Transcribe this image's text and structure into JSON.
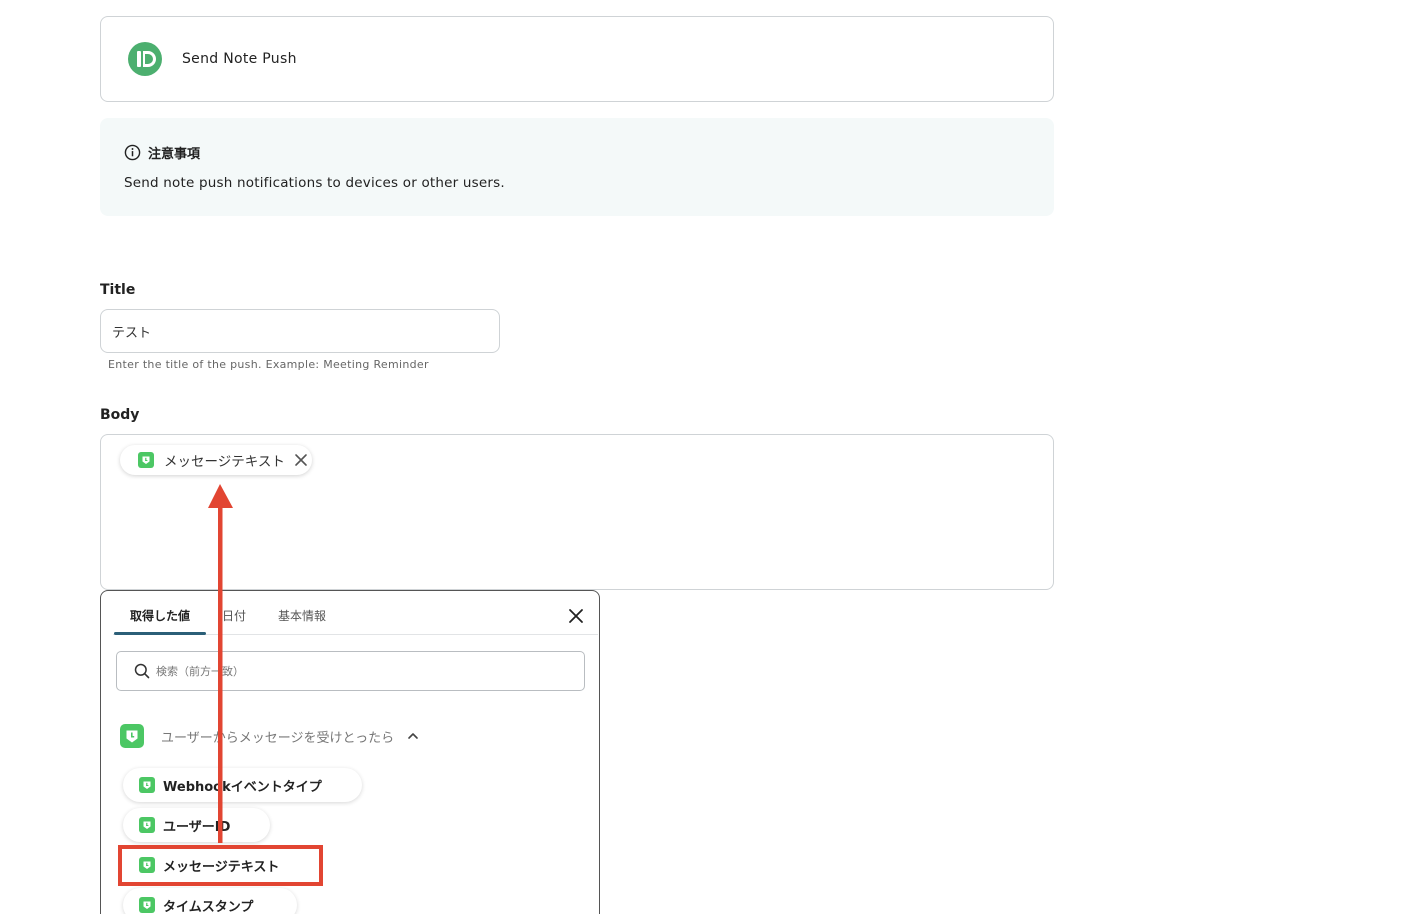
{
  "action": {
    "name": "Send Note Push"
  },
  "notice": {
    "title": "注意事項",
    "text": "Send note push notifications to devices or other users."
  },
  "title_field": {
    "label": "Title",
    "value": "テスト",
    "hint": "Enter the title of the push. Example: Meeting Reminder"
  },
  "body_field": {
    "label": "Body",
    "token": "メッセージテキスト"
  },
  "picker": {
    "tabs": [
      "取得した値",
      "日付",
      "基本情報"
    ],
    "active_tab": "取得した値",
    "search_placeholder": "検索（前方一致）",
    "group_label": "ユーザーからメッセージを受けとったら",
    "options": [
      "Webhookイベントタイプ",
      "ユーザーID",
      "メッセージテキスト",
      "タイムスタンプ"
    ]
  },
  "annotation": {
    "highlighted_option": "メッセージテキスト",
    "color": "#e24532"
  },
  "colors": {
    "line_green": "#4cc764",
    "accent": "#2b5f78"
  }
}
